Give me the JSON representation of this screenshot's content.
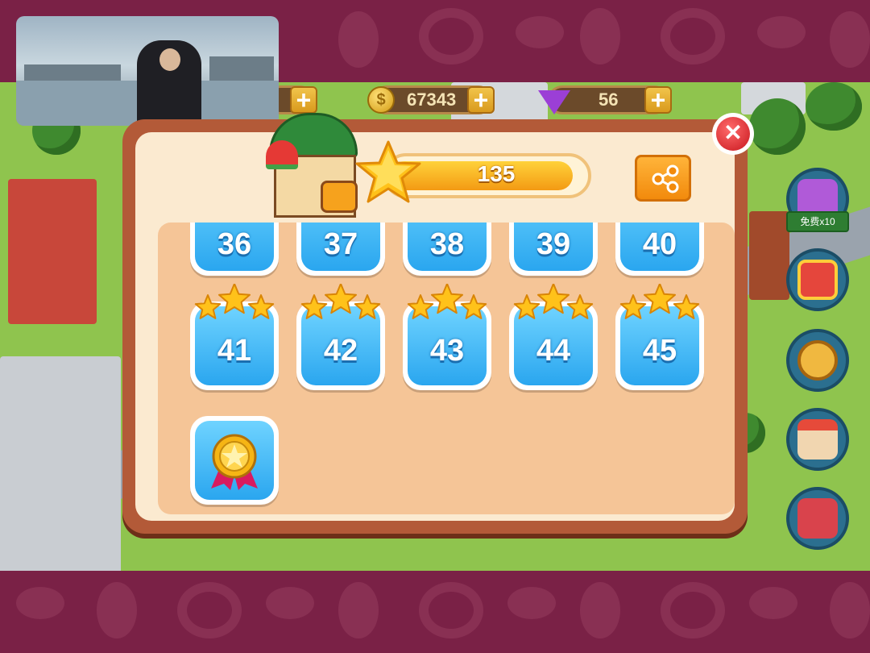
{
  "hud": {
    "coins": "67343",
    "gems": "56",
    "free_label": "免费x10"
  },
  "dialog": {
    "star_total": "135",
    "progress_fraction": 0.94,
    "rows_partial": [
      "36",
      "37",
      "38",
      "39",
      "40"
    ],
    "rows_full": [
      {
        "label": "41",
        "stars": 3
      },
      {
        "label": "42",
        "stars": 3
      },
      {
        "label": "43",
        "stars": 3
      },
      {
        "label": "44",
        "stars": 3
      },
      {
        "label": "45",
        "stars": 3
      }
    ]
  },
  "colors": {
    "band": "#7a2146",
    "tile": "#2aa6ef",
    "star": "#ffc21a",
    "progress": "#f39a13"
  },
  "icons": [
    "shop-icon",
    "star-icon",
    "share-icon",
    "close-icon",
    "medal-icon",
    "coin-icon",
    "gem-icon"
  ]
}
